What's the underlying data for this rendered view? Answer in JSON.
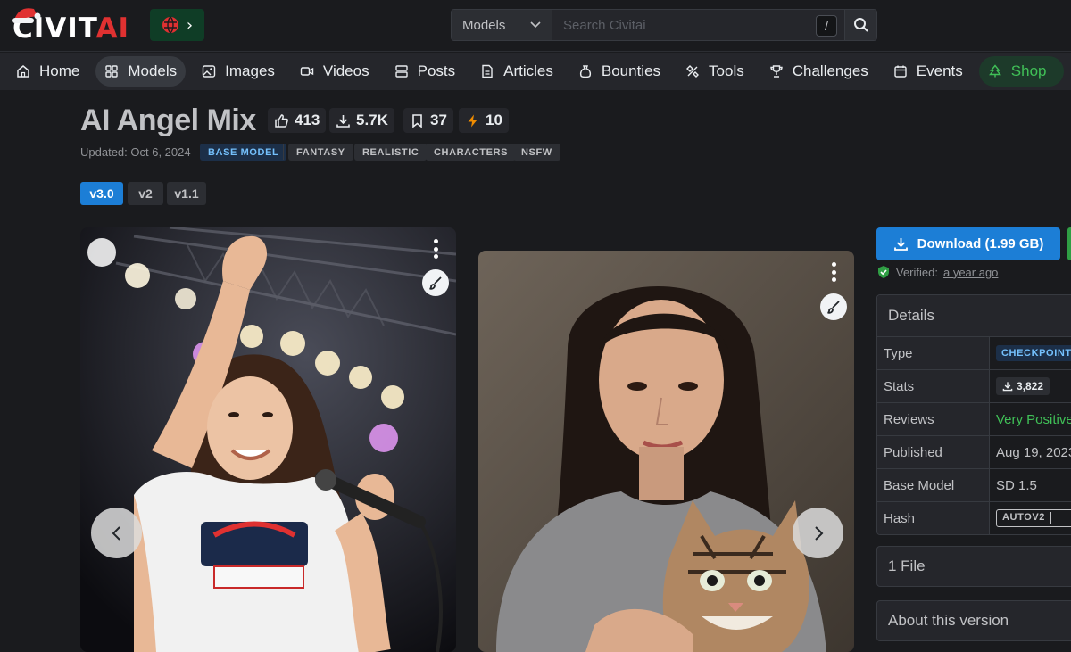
{
  "header": {
    "logo_text_a": "CIVIT",
    "logo_text_b": "AI",
    "search_type": "Models",
    "search_placeholder": "Search Civitai",
    "search_shortcut": "/"
  },
  "nav": {
    "items": [
      {
        "label": "Home",
        "icon": "home-icon"
      },
      {
        "label": "Models",
        "icon": "grid-icon"
      },
      {
        "label": "Images",
        "icon": "image-icon"
      },
      {
        "label": "Videos",
        "icon": "video-icon"
      },
      {
        "label": "Posts",
        "icon": "posts-icon"
      },
      {
        "label": "Articles",
        "icon": "article-icon"
      },
      {
        "label": "Bounties",
        "icon": "moneybag-icon"
      },
      {
        "label": "Tools",
        "icon": "tools-icon"
      },
      {
        "label": "Challenges",
        "icon": "trophy-icon"
      },
      {
        "label": "Events",
        "icon": "calendar-icon"
      },
      {
        "label": "Shop",
        "icon": "tree-icon"
      }
    ],
    "active": "Models"
  },
  "model": {
    "title": "AI Angel Mix",
    "likes": "413",
    "downloads": "5.7K",
    "bookmarks": "37",
    "buzz": "10",
    "updated": "Updated: Oct 6, 2024",
    "tags": [
      "BASE MODEL",
      "FANTASY",
      "REALISTIC",
      "CHARACTERS",
      "NSFW"
    ],
    "versions": [
      "v3.0",
      "v2",
      "v1.1"
    ],
    "active_version": "v3.0"
  },
  "sidebar": {
    "download_label": "Download (1.99 GB)",
    "verified_label": "Verified:",
    "verified_time": "a year ago",
    "details_title": "Details",
    "details": [
      {
        "key": "Type",
        "value": "CHECKPOINT"
      },
      {
        "key": "Stats",
        "value": "3,822"
      },
      {
        "key": "Reviews",
        "value": "Very Positive"
      },
      {
        "key": "Published",
        "value": "Aug 19, 2023"
      },
      {
        "key": "Base Model",
        "value": "SD 1.5"
      },
      {
        "key": "Hash",
        "value": "AUTOV2"
      }
    ],
    "files_label": "1 File",
    "about_label": "About this version"
  },
  "colors": {
    "accent": "#1c7ed6",
    "background": "#1a1b1e",
    "positive": "#40c057",
    "shop": "#40c057"
  }
}
